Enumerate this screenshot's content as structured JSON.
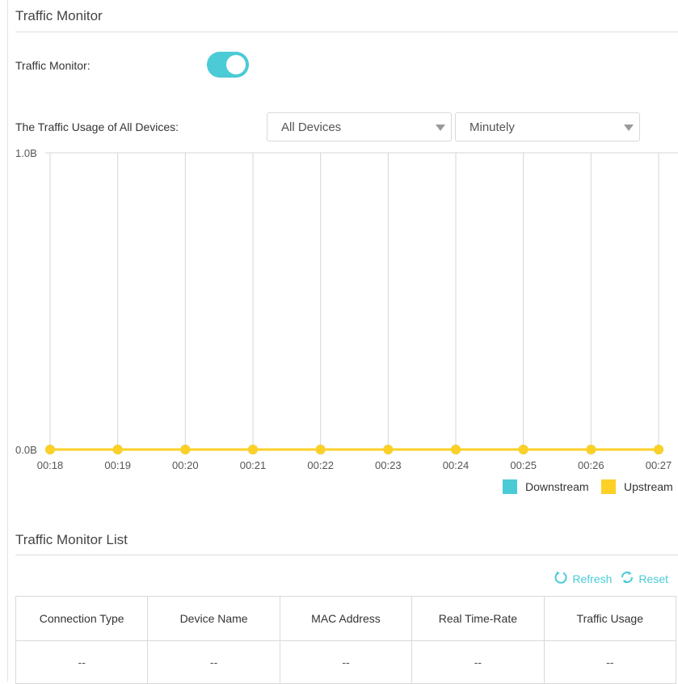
{
  "header": {
    "title": "Traffic Monitor"
  },
  "toggle_row": {
    "label": "Traffic Monitor:",
    "enabled": true
  },
  "usage": {
    "label": "The Traffic Usage of All Devices:",
    "device_select": "All Devices",
    "interval_select": "Minutely"
  },
  "colors": {
    "downstream": "#4acbd6",
    "upstream": "#fcd027",
    "accent": "#4acbd6"
  },
  "chart_data": {
    "type": "line",
    "x": [
      "00:18",
      "00:19",
      "00:20",
      "00:21",
      "00:22",
      "00:23",
      "00:24",
      "00:25",
      "00:26",
      "00:27"
    ],
    "y_tick_labels": [
      "1.0B",
      "0.0B"
    ],
    "ylim": [
      0,
      1
    ],
    "series": [
      {
        "name": "Downstream",
        "values": [
          0,
          0,
          0,
          0,
          0,
          0,
          0,
          0,
          0,
          0
        ]
      },
      {
        "name": "Upstream",
        "values": [
          0,
          0,
          0,
          0,
          0,
          0,
          0,
          0,
          0,
          0
        ]
      }
    ],
    "legend": "bottom-right",
    "grid": "vertical"
  },
  "list": {
    "title": "Traffic Monitor List",
    "refresh_label": "Refresh",
    "reset_label": "Reset",
    "columns": [
      "Connection Type",
      "Device Name",
      "MAC Address",
      "Real Time-Rate",
      "Traffic Usage"
    ],
    "rows": [
      [
        "--",
        "--",
        "--",
        "--",
        "--"
      ]
    ]
  }
}
